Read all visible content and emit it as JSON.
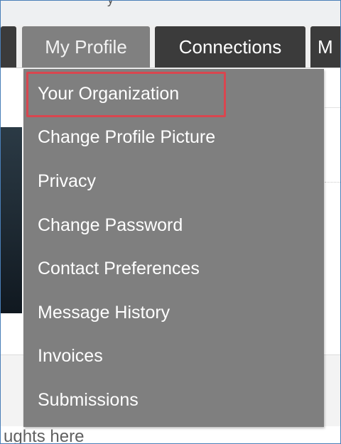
{
  "nav": {
    "tabs": [
      {
        "label": ""
      },
      {
        "label": "My Profile"
      },
      {
        "label": "Connections"
      },
      {
        "label": "M"
      }
    ]
  },
  "dropdown": {
    "items": [
      {
        "label": "Your Organization"
      },
      {
        "label": "Change Profile Picture"
      },
      {
        "label": "Privacy"
      },
      {
        "label": "Change Password"
      },
      {
        "label": "Contact Preferences"
      },
      {
        "label": "Message History"
      },
      {
        "label": "Invoices"
      },
      {
        "label": "Submissions"
      }
    ],
    "highlighted_item": "Your Organization",
    "highlight_color": "#d9464f"
  },
  "page": {
    "footer_text": "ughts here"
  },
  "colors": {
    "tab_dark": "#3b3b3b",
    "tab_active": "#808080",
    "menu_bg": "#7f7f7f"
  }
}
